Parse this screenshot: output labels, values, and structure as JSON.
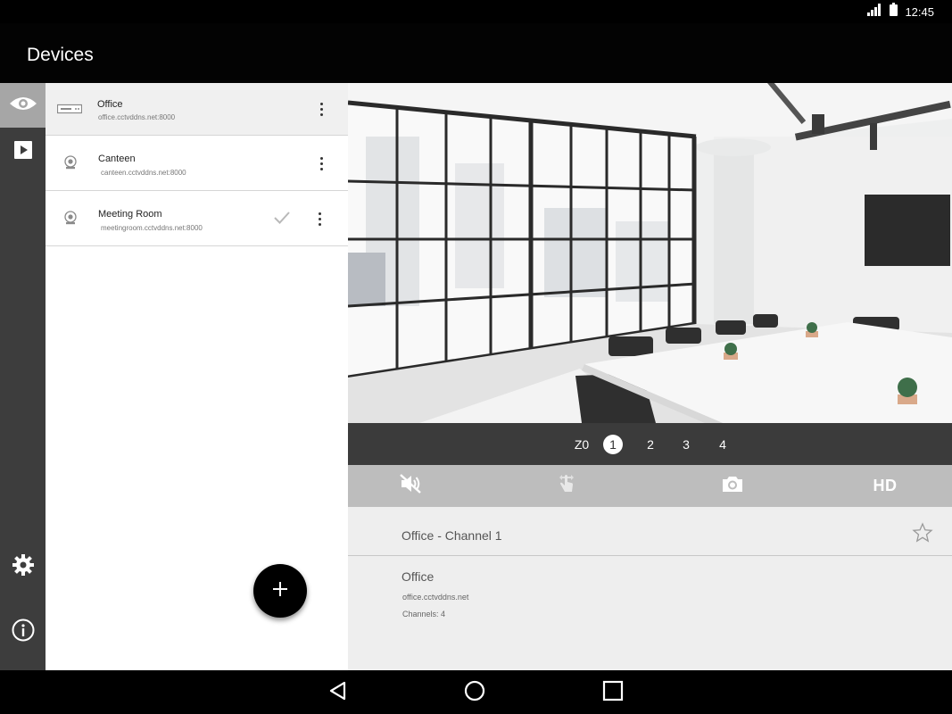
{
  "status_bar": {
    "time": "12:45"
  },
  "app_bar": {
    "title": "Devices"
  },
  "rail": {
    "items": [
      {
        "icon": "eye-icon",
        "active": true
      },
      {
        "icon": "play-icon",
        "active": false
      },
      {
        "icon": "gear-icon",
        "active": false
      },
      {
        "icon": "info-icon",
        "active": false
      }
    ]
  },
  "devices": [
    {
      "name": "Office",
      "url": "office.cctvddns.net:8000",
      "icon": "dvr-icon",
      "selected": true,
      "checked": false
    },
    {
      "name": "Canteen",
      "url": "canteen.cctvddns.net:8000",
      "icon": "camera-icon",
      "selected": false,
      "checked": false
    },
    {
      "name": "Meeting Room",
      "url": "meetingroom.cctvddns.net:8000",
      "icon": "camera-icon",
      "selected": false,
      "checked": true
    }
  ],
  "channel_bar": {
    "zoom_label": "Z0",
    "channels": [
      "1",
      "2",
      "3",
      "4"
    ],
    "selected": "1"
  },
  "toolbar": {
    "tools": [
      "mute-icon",
      "ptz-touch-icon",
      "snapshot-icon"
    ],
    "hd_label": "HD"
  },
  "info": {
    "channel_title": "Office - Channel 1",
    "device_name": "Office",
    "device_url": "office.cctvddns.net",
    "channels_text": "Channels: 4"
  },
  "colors": {
    "app_bar": "#030303",
    "rail": "#3d3d3d",
    "rail_active": "#a6a6a6",
    "channel_bar": "#3b3b3b",
    "toolbar": "#bdbdbd",
    "info_panel": "#eeeeee"
  }
}
